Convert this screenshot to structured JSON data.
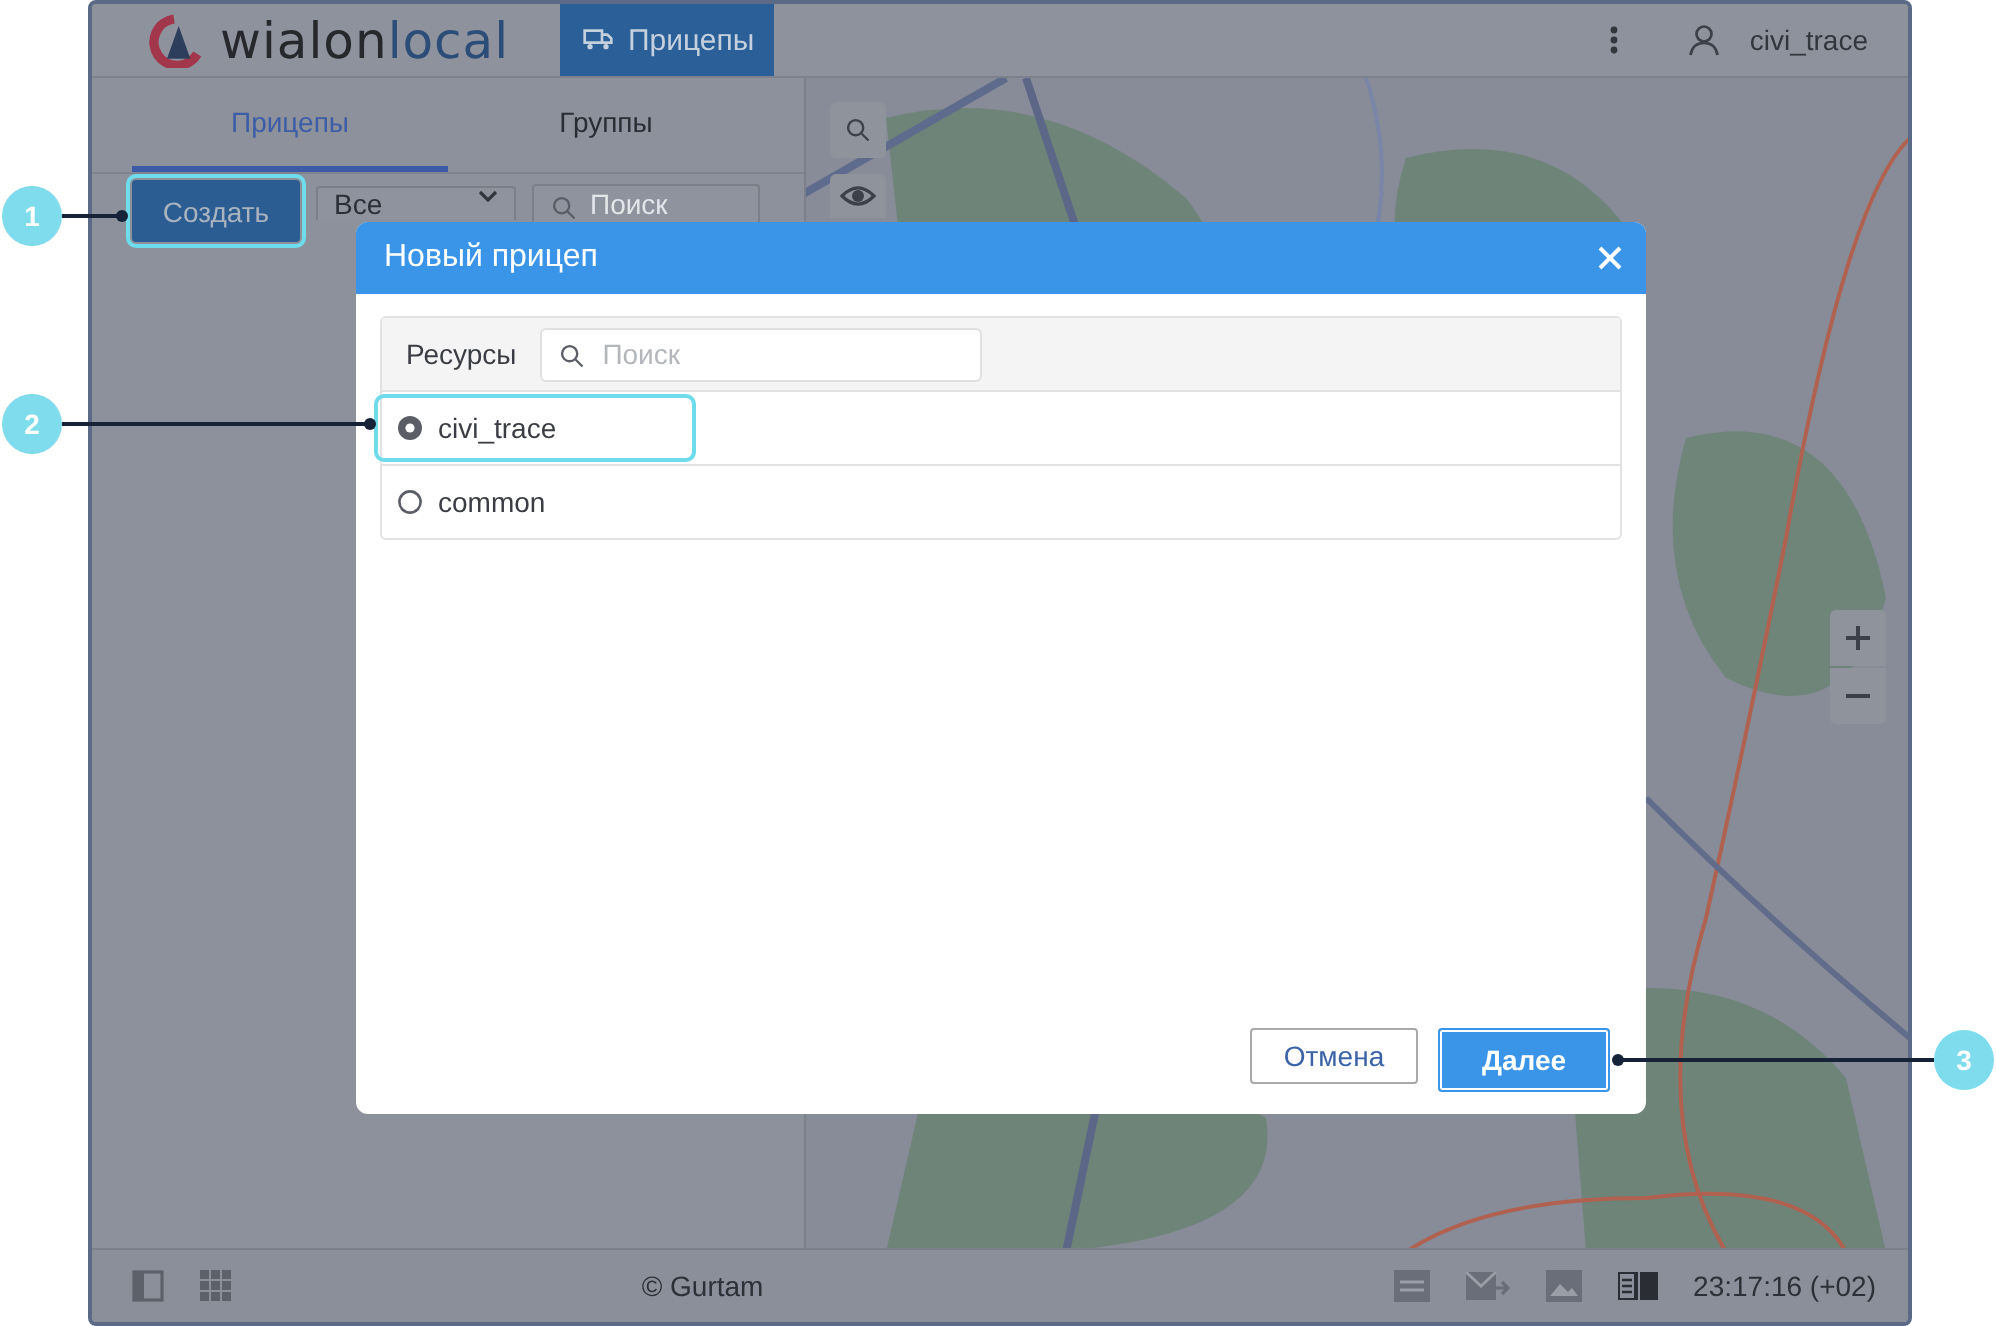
{
  "app_header": {
    "logo": {
      "part1": "wialon",
      "part2": "local"
    },
    "module_tab": {
      "label": "Прицепы",
      "selected": true
    },
    "user": "civi_trace"
  },
  "left_panel": {
    "tabs": [
      {
        "label": "Прицепы",
        "selected": true
      },
      {
        "label": "Группы",
        "selected": false
      }
    ],
    "create_button": {
      "label": "Создать",
      "highlighted": true
    },
    "filter_dropdown": {
      "value": "Все"
    },
    "search": {
      "placeholder": "Поиск"
    }
  },
  "dialog": {
    "title": "Новый прицеп",
    "column_label": "Ресурсы",
    "search": {
      "placeholder": "Поиск"
    },
    "resources": [
      {
        "name": "civi_trace",
        "selected": true,
        "highlighted": true
      },
      {
        "name": "common",
        "selected": false,
        "highlighted": false
      }
    ],
    "buttons": [
      {
        "label": "Отмена",
        "kind": "secondary",
        "highlighted": false
      },
      {
        "label": "Далее",
        "kind": "primary",
        "highlighted": true
      }
    ]
  },
  "status_bar": {
    "copyright": "© Gurtam",
    "time": "23:17:16 (+02)"
  },
  "callouts": [
    {
      "number": "1"
    },
    {
      "number": "2"
    },
    {
      "number": "3"
    }
  ]
}
